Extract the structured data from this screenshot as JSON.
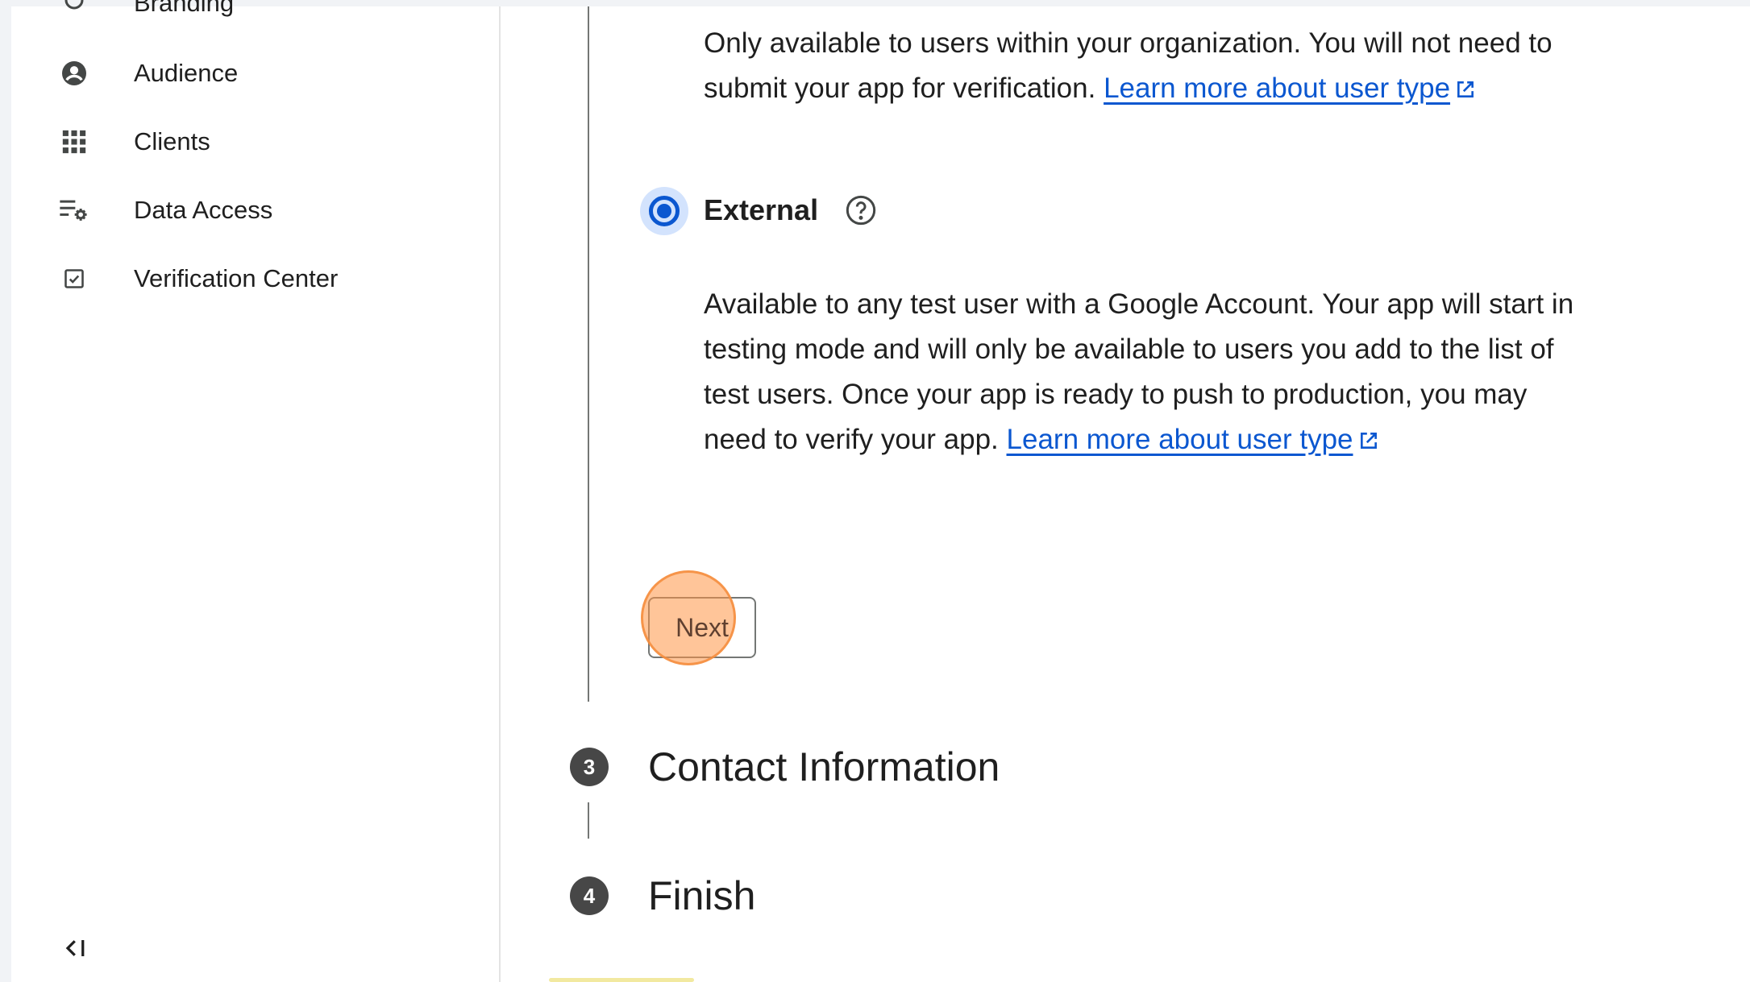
{
  "sidebar": {
    "items": [
      {
        "label": "Branding",
        "icon": "branding-icon"
      },
      {
        "label": "Audience",
        "icon": "account-circle-icon"
      },
      {
        "label": "Clients",
        "icon": "grid-icon"
      },
      {
        "label": "Data Access",
        "icon": "data-access-icon"
      },
      {
        "label": "Verification Center",
        "icon": "checkbox-icon"
      }
    ],
    "collapse_icon": "collapse-sidebar-icon"
  },
  "main": {
    "internal_description": "Only available to users within your organization. You will not need to submit your app for verification.",
    "internal_link": "Learn more about user type",
    "external_option": {
      "label": "External",
      "selected": true,
      "help_icon": "help-circle-icon"
    },
    "external_description": "Available to any test user with a Google Account. Your app will start in testing mode and will only be available to users you add to the list of test users. Once your app is ready to push to production, you may need to verify your app.",
    "external_link": "Learn more about user type",
    "next_button": "Next",
    "steps": [
      {
        "number": "3",
        "title": "Contact Information"
      },
      {
        "number": "4",
        "title": "Finish"
      }
    ]
  },
  "colors": {
    "link": "#0b57d0",
    "radio": "#0b57d0",
    "step_circle": "#474747",
    "click_highlight": "#f59a52"
  }
}
